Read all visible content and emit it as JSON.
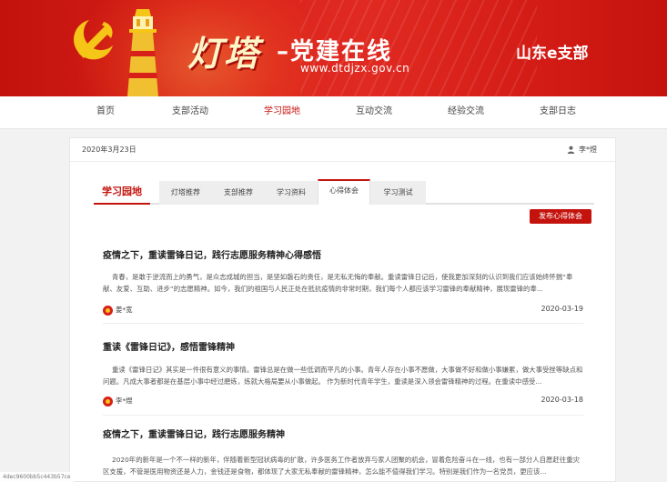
{
  "banner": {
    "logo_calligraphy": "灯塔",
    "site_title": "–党建在线",
    "site_url": "www.dtdjzx.gov.cn",
    "branch_name": "山东e支部"
  },
  "nav": {
    "items": [
      {
        "label": "首页",
        "active": false
      },
      {
        "label": "支部活动",
        "active": false
      },
      {
        "label": "学习园地",
        "active": true
      },
      {
        "label": "互动交流",
        "active": false
      },
      {
        "label": "经验交流",
        "active": false
      },
      {
        "label": "支部日志",
        "active": false
      }
    ]
  },
  "panel": {
    "date": "2020年3月23日",
    "user_name": "李*煜",
    "section_title": "学习园地",
    "tabs": [
      {
        "label": "灯塔推荐",
        "active": false
      },
      {
        "label": "支部推荐",
        "active": false
      },
      {
        "label": "学习资料",
        "active": false
      },
      {
        "label": "心得体会",
        "active": true
      },
      {
        "label": "学习测试",
        "active": false
      }
    ],
    "post_button": "发布心得体会"
  },
  "articles": [
    {
      "title": "疫情之下，重读雷锋日记，践行志愿服务精神心得感悟",
      "body": "青春，是敢于逆流而上的勇气，是众志成城的担当，是坚如磐石的责任，是无私无悔的奉献。重读雷锋日记后，使我更加深刻的认识到我们应该始终怀揣“奉献、友爱、互助、进步”的志愿精神。如今，我们的祖国与人民正处在抵抗疫情的非常时期，我们每个人都应该学习雷锋的奉献精神，展现雷锋的奉...",
      "author": "姜*宽",
      "date": "2020-03-19"
    },
    {
      "title": "重读《雷锋日记》，感悟雷锋精神",
      "body": "重读《雷锋日记》其实是一件很有意义的事情。雷锋总是在做一些低调而平凡的小事。青年人存在小事不愿做，大事做不好和做小事嫌累，做大事受挫等缺点和问题。凡成大事者都是在基层小事中经过磨练，炼就大格局要从小事做起。 作为新时代青年学生，重读是深入领会雷锋精神的过程。在重读中感受...",
      "author": "李*煜",
      "date": "2020-03-18"
    },
    {
      "title": "疫情之下，重读雷锋日记，践行志愿服务精神",
      "body": "2020年的新年是一个不一样的新年，伴随着新型冠状病毒的扩散，许多医务工作者放弃与家人团聚的机会，冒着危险奋斗在一线，也有一部分人自愿赶往重灾区支援，不管是医用物资还是人力，金钱还是食物，都体现了大家无私奉献的雷锋精神，怎么能不值得我们学习。特别是我们作为一名党员，更应该...",
      "author": "",
      "date": ""
    }
  ],
  "footer_hash": "4dec9600bb5c443b57ce",
  "colors": {
    "brand_red": "#c4130d",
    "banner_red": "#d8201a"
  }
}
